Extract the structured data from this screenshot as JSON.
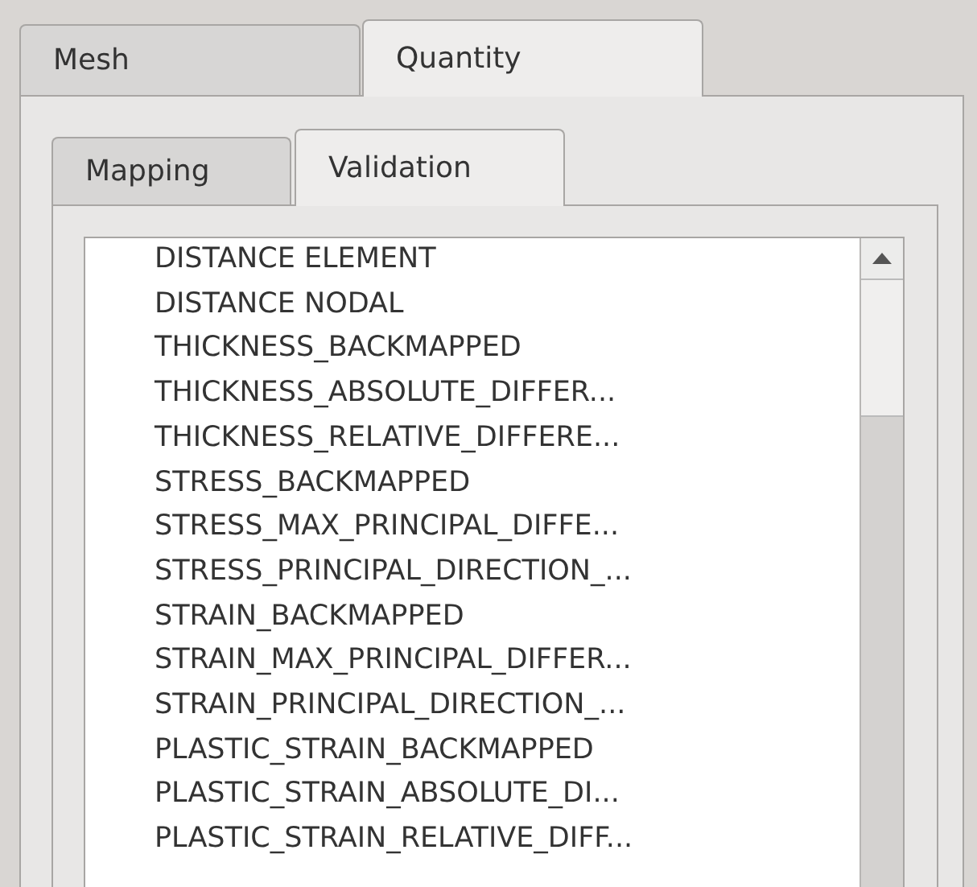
{
  "tabs": [
    {
      "label": "Mesh",
      "selected": false
    },
    {
      "label": "Quantity",
      "selected": true
    }
  ],
  "subtabs": [
    {
      "label": "Mapping",
      "selected": false
    },
    {
      "label": "Validation",
      "selected": true
    }
  ],
  "list": {
    "items": [
      {
        "label": "DISTANCE ELEMENT"
      },
      {
        "label": "DISTANCE NODAL"
      },
      {
        "label": "THICKNESS_BACKMAPPED"
      },
      {
        "label": "THICKNESS_ABSOLUTE_DIFFER..."
      },
      {
        "label": "THICKNESS_RELATIVE_DIFFERE..."
      },
      {
        "label": "STRESS_BACKMAPPED"
      },
      {
        "label": "STRESS_MAX_PRINCIPAL_DIFFE..."
      },
      {
        "label": "STRESS_PRINCIPAL_DIRECTION_..."
      },
      {
        "label": "STRAIN_BACKMAPPED"
      },
      {
        "label": "STRAIN_MAX_PRINCIPAL_DIFFER..."
      },
      {
        "label": "STRAIN_PRINCIPAL_DIRECTION_..."
      },
      {
        "label": "PLASTIC_STRAIN_BACKMAPPED"
      },
      {
        "label": "PLASTIC_STRAIN_ABSOLUTE_DI..."
      },
      {
        "label": "PLASTIC_STRAIN_RELATIVE_DIFF..."
      }
    ]
  }
}
